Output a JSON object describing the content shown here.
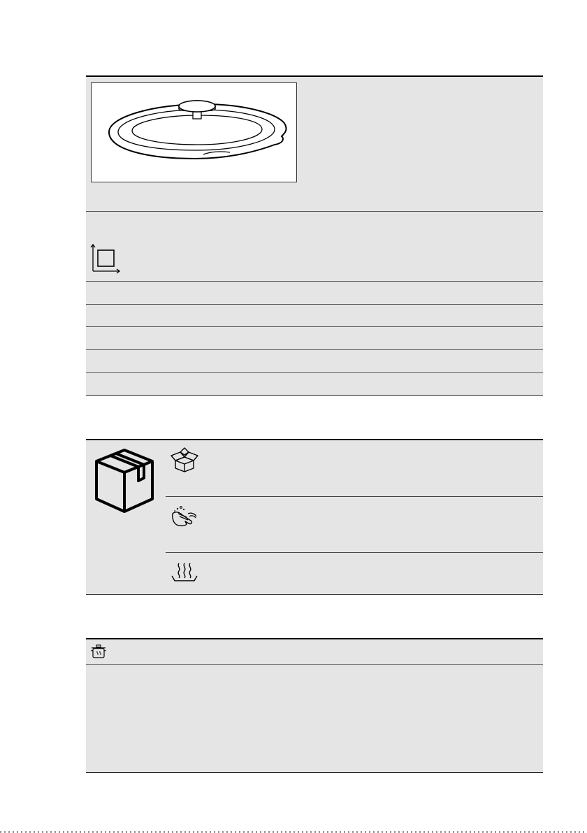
{
  "page": {
    "product_figure": {
      "name": "glass-lid-illustration"
    },
    "dimensions_section": {
      "icon": "dimensions-icon",
      "rows": [
        "",
        "",
        "",
        "",
        ""
      ]
    },
    "handling_section": {
      "main_icon": "cardboard-box-icon",
      "steps": [
        {
          "icon": "unpack-box-icon",
          "text": ""
        },
        {
          "icon": "wash-hands-icon",
          "text": ""
        },
        {
          "icon": "heat-steam-icon",
          "text": ""
        }
      ]
    },
    "cooking_section": {
      "header_icon": "steam-pot-icon",
      "header_text": "",
      "body_text": ""
    },
    "colors": {
      "panel": "#e5e5e5",
      "rule": "#000000"
    }
  }
}
